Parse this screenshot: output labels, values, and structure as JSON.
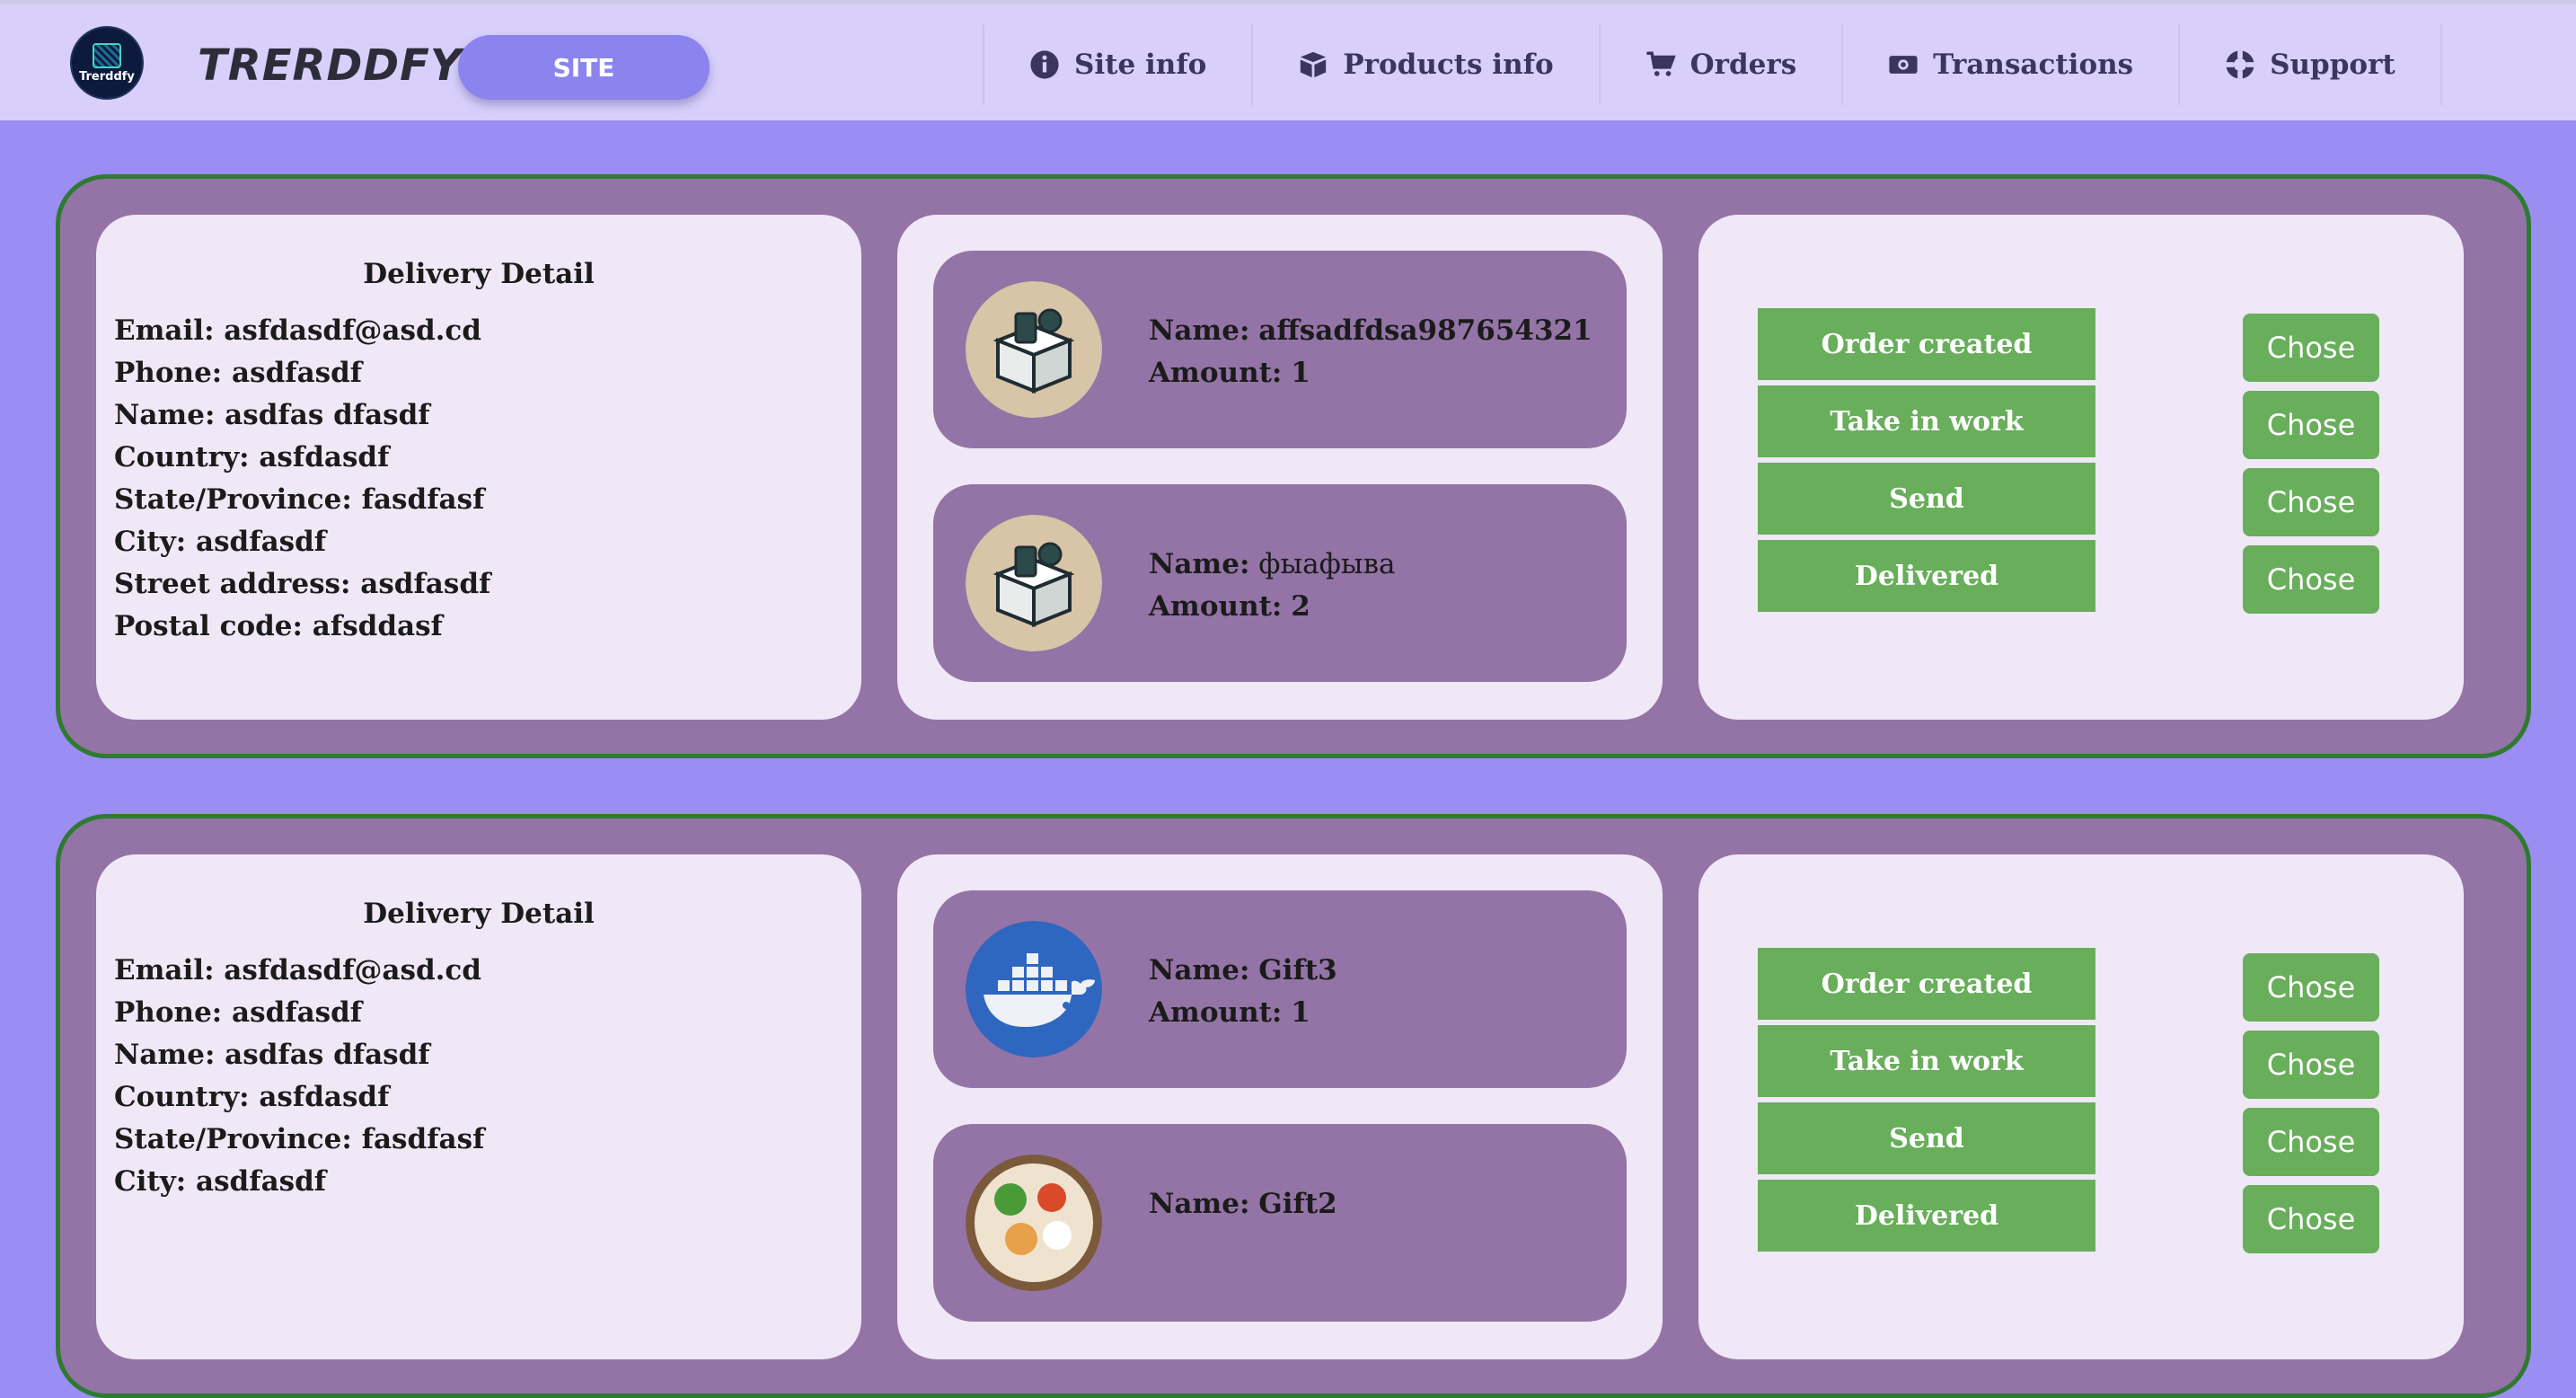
{
  "header": {
    "logo_caption": "Trerddfy",
    "brand": "TRERDDFY",
    "site_button": "SITE",
    "nav": [
      {
        "label": "Site info",
        "icon": "info-icon"
      },
      {
        "label": "Products info",
        "icon": "box-icon"
      },
      {
        "label": "Orders",
        "icon": "cart-icon"
      },
      {
        "label": "Transactions",
        "icon": "money-icon"
      },
      {
        "label": "Support",
        "icon": "lifebuoy-icon"
      }
    ]
  },
  "orders": [
    {
      "details": {
        "title": "Delivery Detail",
        "lines": [
          "Email: asfdasdf@asd.cd",
          "Phone: asdfasdf",
          "Name: asdfas dfasdf",
          "Country: asfdasdf",
          "State/Province: fasdfasf",
          "City: asdfasdf",
          "Street address: asdfasdf",
          "Postal code: afsddasf"
        ]
      },
      "items": [
        {
          "name_label": "Name:",
          "name": "affsadfdsa987654321",
          "amount_label": "Amount:",
          "amount": "1",
          "image": "package-icon"
        },
        {
          "name_label": "Name:",
          "name": "фыафыва",
          "amount_label": "Amount:",
          "amount": "2",
          "image": "package-icon"
        }
      ],
      "statuses": [
        "Order created",
        "Take in work",
        "Send",
        "Delivered"
      ],
      "chose_label": "Chose"
    },
    {
      "details": {
        "title": "Delivery Detail",
        "lines": [
          "Email: asfdasdf@asd.cd",
          "Phone: asdfasdf",
          "Name: asdfas dfasdf",
          "Country: asfdasdf",
          "State/Province: fasdfasf",
          "City: asdfasdf"
        ]
      },
      "items": [
        {
          "name_label": "Name:",
          "name": "Gift3",
          "amount_label": "Amount:",
          "amount": "1",
          "image": "docker-whale-icon"
        },
        {
          "name_label": "Name:",
          "name": "Gift2",
          "amount_label": "",
          "amount": "",
          "image": "food-bowl-icon"
        }
      ],
      "statuses": [
        "Order created",
        "Take in work",
        "Send",
        "Delivered"
      ],
      "chose_label": "Chose"
    }
  ],
  "colors": {
    "page_bg": "#9a8ef2",
    "header_bg": "#d8d0fa",
    "card_bg": "#9474a6",
    "card_border": "#2f7a32",
    "panel_bg": "#f0e8f6",
    "status_green": "#68ae5b",
    "site_button": "#8b84ef"
  }
}
